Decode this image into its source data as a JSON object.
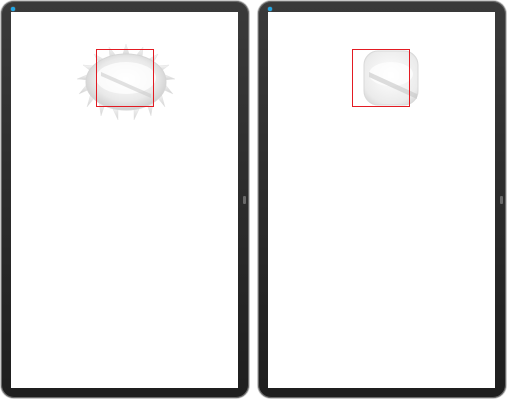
{
  "screens": [
    {
      "id": "left",
      "graphic": "starburst-badge-icon",
      "highlight": true
    },
    {
      "id": "right",
      "graphic": "cropped-tile-icon",
      "highlight": true
    }
  ],
  "colors": {
    "bezel": "#262626",
    "screen": "#ffffff",
    "camera": "#1ea7e8",
    "highlight": "#e31b23"
  }
}
